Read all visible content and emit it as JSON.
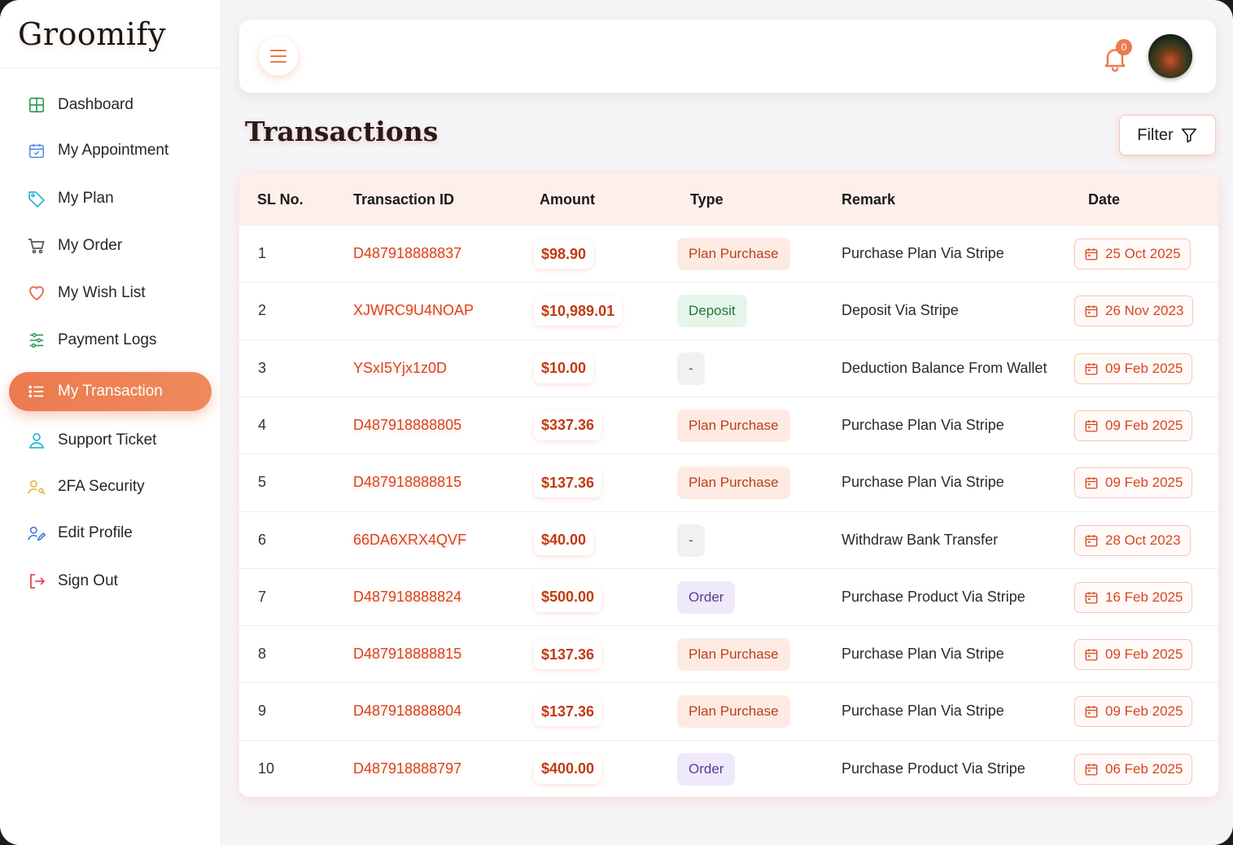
{
  "app": {
    "logo": "Groomify"
  },
  "sidebar": {
    "items": [
      {
        "label": "Dashboard",
        "icon": "grid-icon",
        "color": "#2e9b5a"
      },
      {
        "label": "My Appointment",
        "icon": "calendar-check-icon",
        "color": "#5b8de8"
      },
      {
        "label": "My Plan",
        "icon": "tag-icon",
        "color": "#2fb4d6"
      },
      {
        "label": "My Order",
        "icon": "cart-icon",
        "color": "#555555"
      },
      {
        "label": "My Wish List",
        "icon": "heart-icon",
        "color": "#ec6a4f"
      },
      {
        "label": "Payment Logs",
        "icon": "sliders-icon",
        "color": "#2e9b5a"
      },
      {
        "label": "My Transaction",
        "icon": "list-icon",
        "color": "#ffffff",
        "active": true
      },
      {
        "label": "Support Ticket",
        "icon": "user-circle-icon",
        "color": "#2fb4d6"
      },
      {
        "label": "2FA Security",
        "icon": "user-key-icon",
        "color": "#e8b23a"
      },
      {
        "label": "Edit Profile",
        "icon": "user-edit-icon",
        "color": "#3b78d6"
      },
      {
        "label": "Sign Out",
        "icon": "sign-out-icon",
        "color": "#e5485a"
      }
    ]
  },
  "topbar": {
    "notification_count": "0"
  },
  "page": {
    "title": "Transactions",
    "filter_label": "Filter"
  },
  "table": {
    "headers": [
      "SL No.",
      "Transaction ID",
      "Amount",
      "Type",
      "Remark",
      "Date"
    ],
    "rows": [
      {
        "sl": "1",
        "id": "D487918888837",
        "amount": "$98.90",
        "type": "Plan Purchase",
        "type_kind": "plan",
        "remark": "Purchase Plan Via Stripe",
        "date": "25 Oct 2025"
      },
      {
        "sl": "2",
        "id": "XJWRC9U4NOAP",
        "amount": "$10,989.01",
        "type": "Deposit",
        "type_kind": "dep",
        "remark": "Deposit Via Stripe",
        "date": "26 Nov 2023"
      },
      {
        "sl": "3",
        "id": "YSxI5Yjx1z0D",
        "amount": "$10.00",
        "type": "-",
        "type_kind": "none",
        "remark": "Deduction Balance From Wallet",
        "date": "09 Feb 2025"
      },
      {
        "sl": "4",
        "id": "D487918888805",
        "amount": "$337.36",
        "type": "Plan Purchase",
        "type_kind": "plan",
        "remark": "Purchase Plan Via Stripe",
        "date": "09 Feb 2025"
      },
      {
        "sl": "5",
        "id": "D487918888815",
        "amount": "$137.36",
        "type": "Plan Purchase",
        "type_kind": "plan",
        "remark": "Purchase Plan Via Stripe",
        "date": "09 Feb 2025"
      },
      {
        "sl": "6",
        "id": "66DA6XRX4QVF",
        "amount": "$40.00",
        "type": "-",
        "type_kind": "none",
        "remark": "Withdraw Bank Transfer",
        "date": "28 Oct 2023"
      },
      {
        "sl": "7",
        "id": "D487918888824",
        "amount": "$500.00",
        "type": "Order",
        "type_kind": "order",
        "remark": "Purchase Product Via Stripe",
        "date": "16 Feb 2025"
      },
      {
        "sl": "8",
        "id": "D487918888815",
        "amount": "$137.36",
        "type": "Plan Purchase",
        "type_kind": "plan",
        "remark": "Purchase Plan Via Stripe",
        "date": "09 Feb 2025"
      },
      {
        "sl": "9",
        "id": "D487918888804",
        "amount": "$137.36",
        "type": "Plan Purchase",
        "type_kind": "plan",
        "remark": "Purchase Plan Via Stripe",
        "date": "09 Feb 2025"
      },
      {
        "sl": "10",
        "id": "D487918888797",
        "amount": "$400.00",
        "type": "Order",
        "type_kind": "order",
        "remark": "Purchase Product Via Stripe",
        "date": "06 Feb 2025"
      }
    ]
  },
  "colors": {
    "accent": "#ec7a4f",
    "id_text": "#d9451f",
    "amount_text": "#c23a12"
  }
}
